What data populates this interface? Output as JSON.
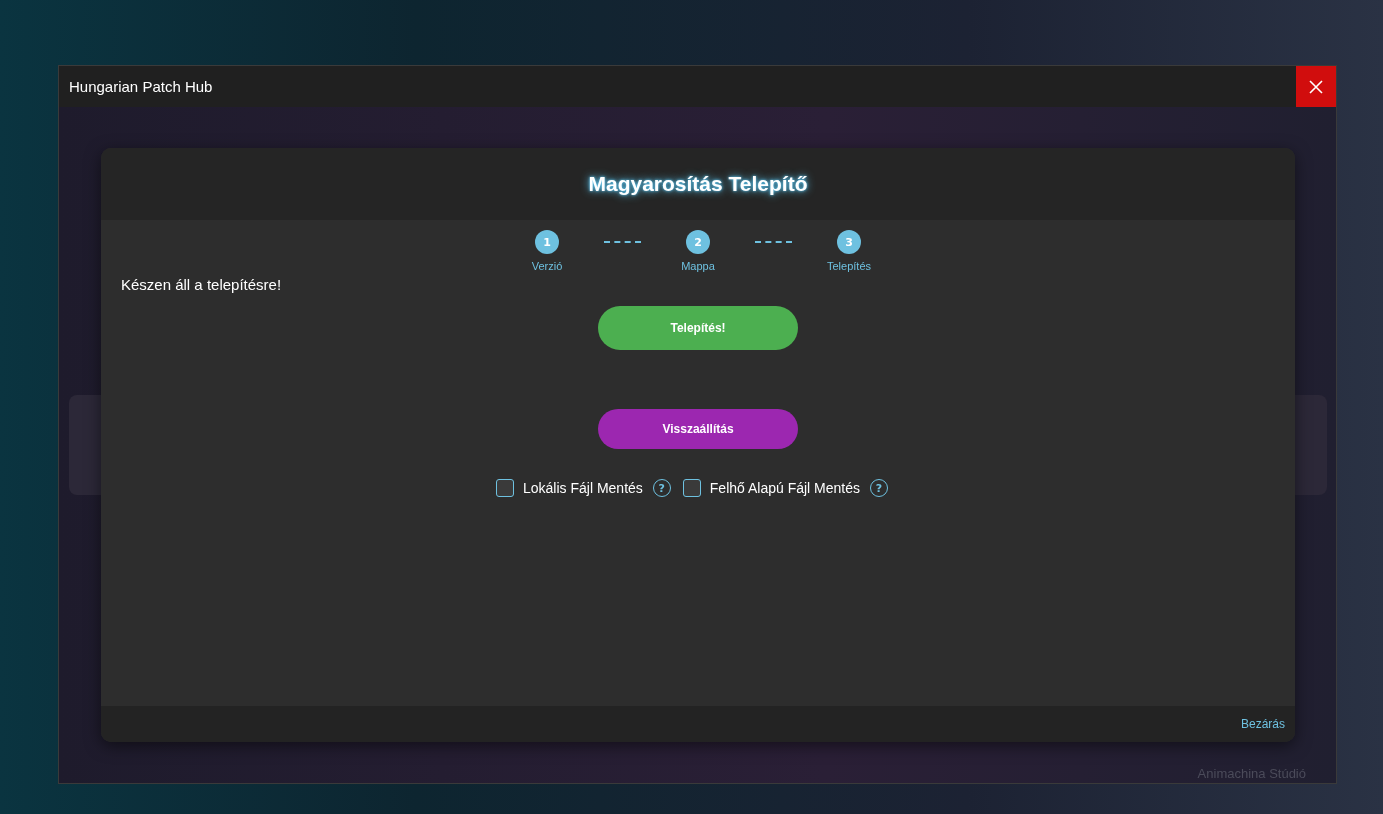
{
  "window": {
    "title": "Hungarian Patch Hub"
  },
  "dialog": {
    "title": "Magyarosítás Telepítő",
    "steps": [
      {
        "number": "1",
        "label": "Verzió",
        "done": true
      },
      {
        "number": "2",
        "label": "Mappa",
        "done": true
      },
      {
        "number": "3",
        "label": "Telepítés",
        "done": true
      }
    ],
    "status": "Készen áll a telepítésre!",
    "buttons": [
      {
        "label": "Telepítés!",
        "kind": "install"
      },
      {
        "label": "Visszaállítás",
        "kind": "restore"
      }
    ],
    "options": [
      {
        "label": "Lokális Fájl Mentés",
        "checked": false,
        "help": "?"
      },
      {
        "label": "Felhő Alapú Fájl Mentés",
        "checked": false,
        "help": "?"
      }
    ],
    "close_link": "Bezárás"
  },
  "footer": "Animachina Stúdió"
}
